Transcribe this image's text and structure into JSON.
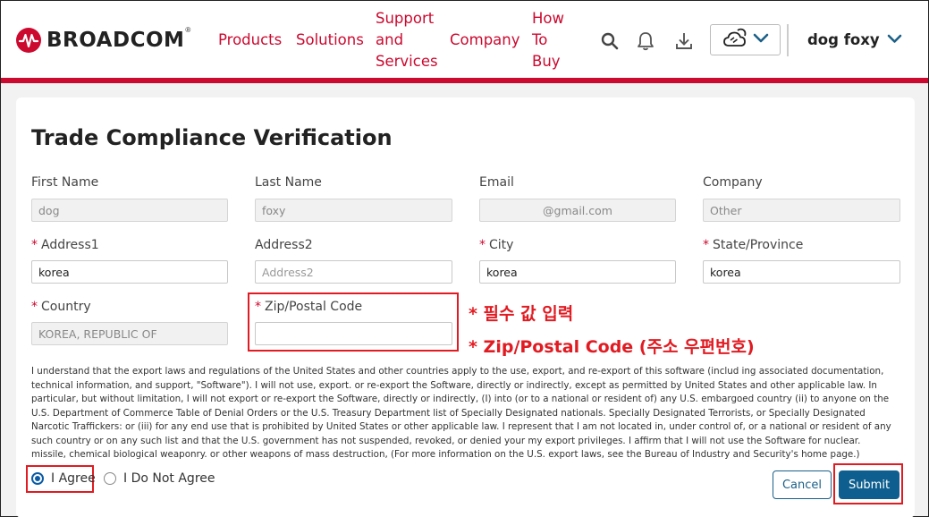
{
  "header": {
    "brand": "BROADCOM",
    "brand_mark": "®",
    "nav": [
      {
        "label": "Products"
      },
      {
        "label": "Solutions"
      },
      {
        "label": "Support\nand\nServices"
      },
      {
        "label": "Company"
      },
      {
        "label": "How\nTo\nBuy"
      }
    ],
    "icons": [
      "search-icon",
      "bell-icon",
      "download-icon",
      "weather-icon",
      "chevron-down-icon"
    ],
    "user_name": "dog foxy",
    "accent_color": "#cc092f"
  },
  "form": {
    "title": "Trade Compliance Verification",
    "fields": {
      "first_name": {
        "label": "First Name",
        "value": "dog"
      },
      "last_name": {
        "label": "Last Name",
        "value": "foxy"
      },
      "email": {
        "label": "Email",
        "value": "@gmail.com"
      },
      "company": {
        "label": "Company",
        "value": "Other"
      },
      "address1": {
        "label": "Address1",
        "required": "*",
        "value": "korea"
      },
      "address2": {
        "label": "Address2",
        "placeholder": "Address2",
        "value": ""
      },
      "city": {
        "label": "City",
        "required": "*",
        "value": "korea"
      },
      "state": {
        "label": "State/Province",
        "required": "*",
        "value": "korea"
      },
      "country": {
        "label": "Country",
        "required": "*",
        "value": "KOREA, REPUBLIC OF"
      },
      "zip": {
        "label": "Zip/Postal Code",
        "required": "*",
        "value": ""
      }
    },
    "annotations": {
      "line1": "* 필수 값 입력",
      "line2": "* Zip/Postal Code (주소 우편번호)"
    },
    "legal_text": "I understand that the export laws and regulations of the United States and other countries apply to the use, export, and re-export of this software (includ ing associated documentation, technical information, and support, \"Software\"). I will not use, export. or re-export the Software, directly or indirectly, except as permitted by United States and other applicable law. In particular, but without limitation, I will not export or re-export the Software, directly or indirectly, (I) into (or to a national or resident of) any U.S. embargoed country (ii) to anyone on the U.S. Department of Commerce Table of Denial Orders or the U.S. Treasury Department list of Specially Designated nationals. Specially Designated Terrorists, or Specially Designated Narcotic Traffickers: or (iii) for any end use that is prohibited by United States or other applicable law. I represent that I am not located in, under control of, or a national or resident of any such country or on any such list and that the U.S. government has not suspended, revoked, or denied your my export privileges. I affirm that I will not use the Software for nuclear. missile, chemical biological weaponry. or other weapons of mass destruction, (For more information on the U.S. export laws, see the Bureau of Industry and Security's home page.)",
    "agree_label": "I Agree",
    "disagree_label": "I Do Not Agree",
    "cancel_label": "Cancel",
    "submit_label": "Submit",
    "highlight_color": "#e11b22"
  }
}
